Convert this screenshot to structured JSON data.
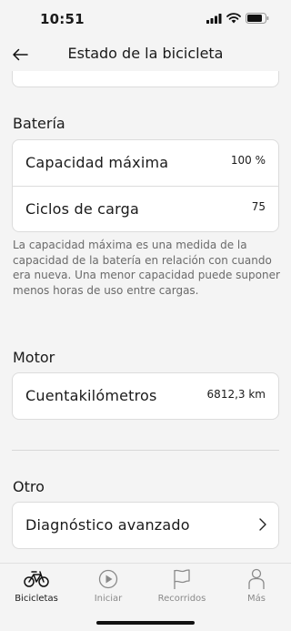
{
  "status": {
    "time": "10:51"
  },
  "nav": {
    "title": "Estado de la bicicleta"
  },
  "battery": {
    "title": "Batería",
    "rows": [
      {
        "label": "Capacidad máxima",
        "value": "100 %"
      },
      {
        "label": "Ciclos de carga",
        "value": "75"
      }
    ],
    "note": "La capacidad máxima es una medida de la capacidad de la batería en relación con cuando era nueva. Una menor capacidad puede suponer menos horas de uso entre cargas."
  },
  "motor": {
    "title": "Motor",
    "rows": [
      {
        "label": "Cuentakilómetros",
        "value": "6812,3 km"
      }
    ]
  },
  "other": {
    "title": "Otro",
    "rows": [
      {
        "label": "Diagnóstico avanzado"
      }
    ]
  },
  "tabs": [
    {
      "label": "Bicicletas",
      "icon": "bicycle-icon",
      "active": true
    },
    {
      "label": "Iniciar",
      "icon": "play-icon",
      "active": false
    },
    {
      "label": "Recorridos",
      "icon": "flag-icon",
      "active": false
    },
    {
      "label": "Más",
      "icon": "person-icon",
      "active": false
    }
  ]
}
